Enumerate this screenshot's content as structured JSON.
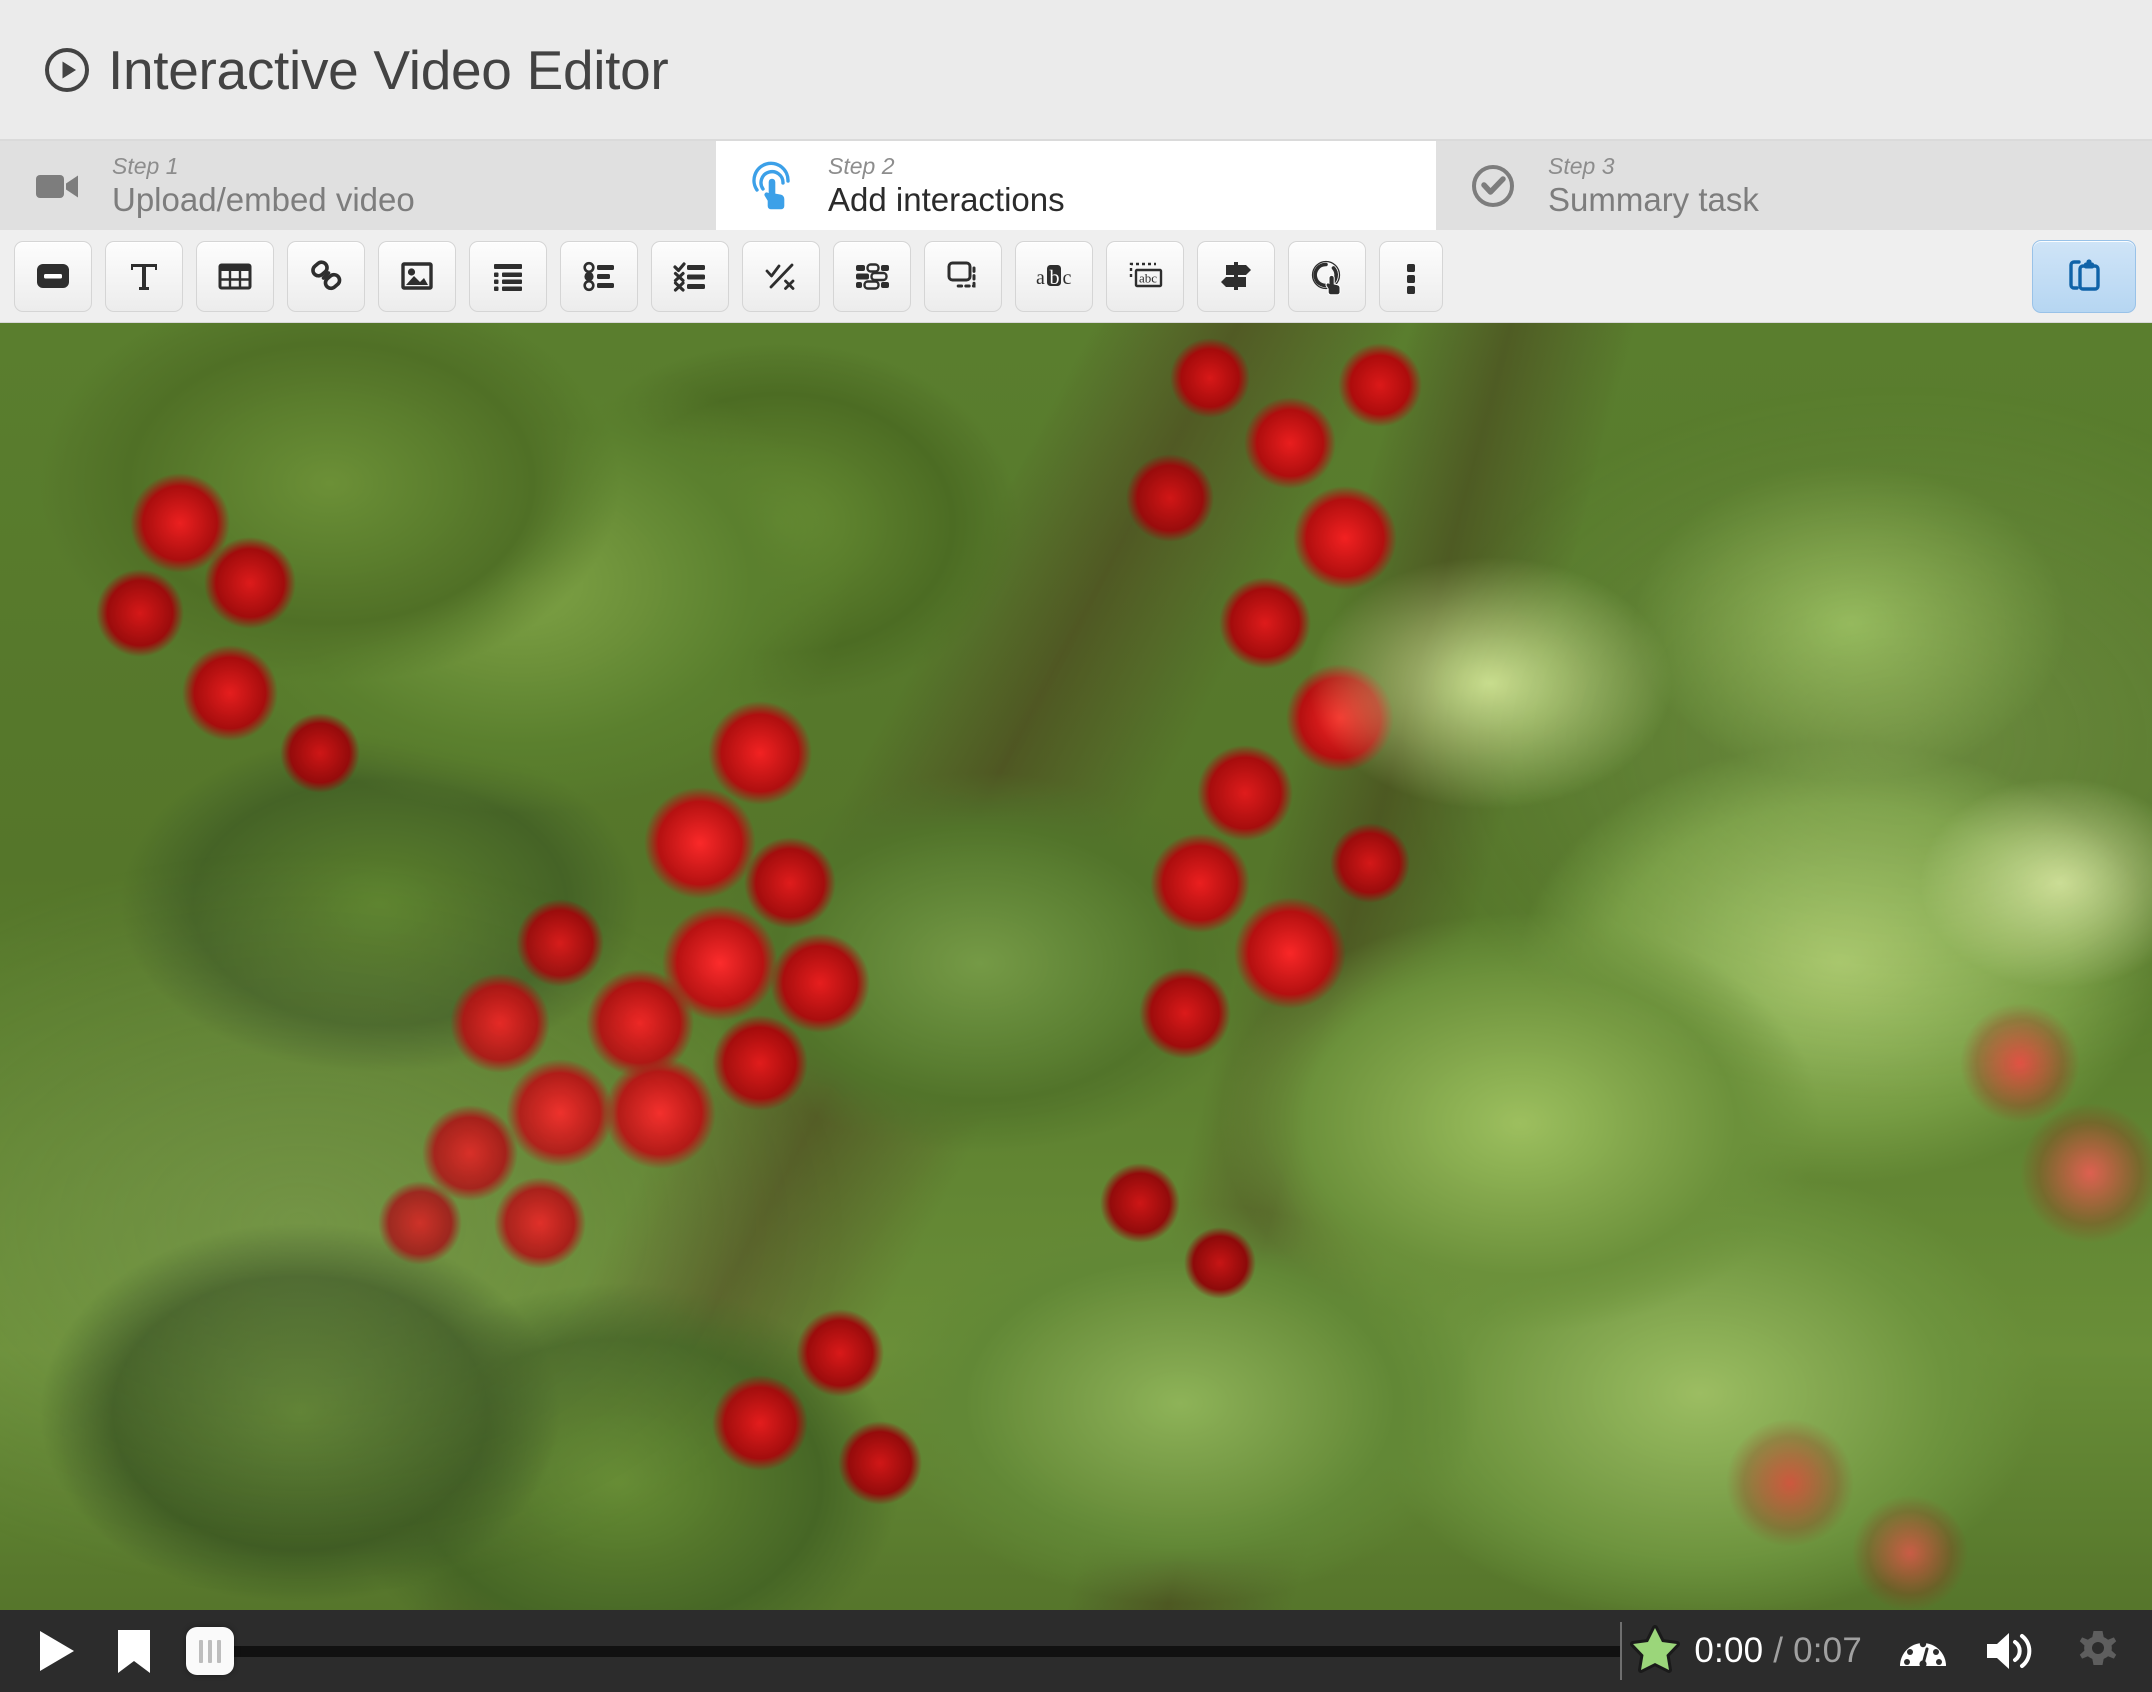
{
  "header": {
    "title": "Interactive Video Editor",
    "play_icon": "play-circle-icon"
  },
  "steps": [
    {
      "number": "Step 1",
      "label": "Upload/embed video",
      "icon": "video-camera-icon",
      "active": false
    },
    {
      "number": "Step 2",
      "label": "Add interactions",
      "icon": "touch-pointer-icon",
      "active": true
    },
    {
      "number": "Step 3",
      "label": "Summary task",
      "icon": "check-circle-icon",
      "active": false
    }
  ],
  "toolbar": {
    "buttons": [
      {
        "name": "label-tool",
        "icon": "label-minus-icon"
      },
      {
        "name": "text-tool",
        "icon": "text-t-icon"
      },
      {
        "name": "table-tool",
        "icon": "table-icon"
      },
      {
        "name": "link-tool",
        "icon": "link-chain-icon"
      },
      {
        "name": "image-tool",
        "icon": "image-picture-icon"
      },
      {
        "name": "statements-tool",
        "icon": "bulleted-list-icon"
      },
      {
        "name": "single-choice-tool",
        "icon": "radio-list-icon"
      },
      {
        "name": "multiple-choice-tool",
        "icon": "checkmark-cross-list-icon"
      },
      {
        "name": "true-false-tool",
        "icon": "check-slash-cross-icon"
      },
      {
        "name": "drag-words-tool",
        "icon": "drag-words-blocks-icon"
      },
      {
        "name": "drag-drop-tool",
        "icon": "drag-drop-dashed-box-icon"
      },
      {
        "name": "mark-words-tool",
        "icon": "abc-highlight-icon"
      },
      {
        "name": "fill-blanks-tool",
        "icon": "dashed-abc-box-icon"
      },
      {
        "name": "crossroads-tool",
        "icon": "signpost-icon"
      },
      {
        "name": "navigation-hotspot-tool",
        "icon": "circle-hand-cursor-icon"
      },
      {
        "name": "more-tools",
        "icon": "vertical-ellipsis-icon"
      }
    ],
    "paste_button": {
      "name": "paste-button",
      "icon": "clipboard-paste-icon"
    }
  },
  "video": {
    "alt": "Red currant berries on a bush with green leaves",
    "controls": {
      "play_icon": "play-triangle-icon",
      "bookmark_icon": "bookmark-icon",
      "seek_handle_icon": "seek-handle-icon",
      "star_marker_icon": "green-star-marker-icon",
      "current_time": "0:00",
      "time_separator": " / ",
      "total_time": "0:07",
      "speed_icon": "speedometer-icon",
      "volume_icon": "volume-high-icon",
      "settings_icon": "gear-icon"
    },
    "progress_percent": 0
  },
  "colors": {
    "accent_blue": "#3ca0e8",
    "paste_blue": "#1063a8",
    "header_bg": "#ebebeb",
    "tab_inactive_bg": "#e0e0e0",
    "tab_active_bg": "#ffffff",
    "toolbar_bg": "#efefef",
    "controls_bg": "#2c2c2c",
    "star_green": "#9bd67a"
  }
}
